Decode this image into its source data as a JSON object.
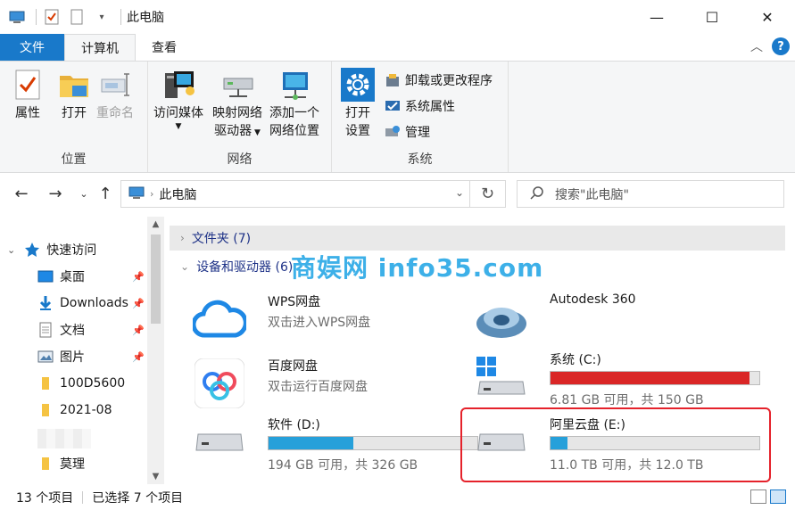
{
  "window": {
    "title": "此电脑"
  },
  "tabs": {
    "file": "文件",
    "computer": "计算机",
    "view": "查看"
  },
  "ribbon": {
    "location": {
      "label": "位置",
      "properties": "属性",
      "open": "打开",
      "rename": "重命名"
    },
    "network": {
      "label": "网络",
      "media": "访问媒体",
      "map_drive_1": "映射网络",
      "map_drive_2": "驱动器",
      "add_loc_1": "添加一个",
      "add_loc_2": "网络位置"
    },
    "system": {
      "label": "系统",
      "settings_1": "打开",
      "settings_2": "设置",
      "uninstall": "卸载或更改程序",
      "sys_props": "系统属性",
      "manage": "管理"
    }
  },
  "address": {
    "path": "此电脑",
    "search_placeholder": "搜索\"此电脑\""
  },
  "nav": {
    "quick_access": "快速访问",
    "items": [
      "桌面",
      "Downloads",
      "文档",
      "图片",
      "100D5600",
      "2021-08",
      "莫理"
    ]
  },
  "content": {
    "folders_section": "文件夹 (7)",
    "devices_section": "设备和驱动器 (6)",
    "watermark": "商娱网 info35.com",
    "wps": {
      "name": "WPS网盘",
      "sub": "双击进入WPS网盘"
    },
    "autodesk": {
      "name": "Autodesk 360"
    },
    "baidu": {
      "name": "百度网盘",
      "sub": "双击运行百度网盘"
    },
    "drive_c": {
      "name": "系统 (C:)",
      "free": "6.81 GB 可用，共 150 GB",
      "used_fraction": 0.955,
      "bar_color": "#da2626"
    },
    "drive_d": {
      "name": "软件 (D:)",
      "free": "194 GB 可用，共 326 GB",
      "used_fraction": 0.405,
      "bar_color": "#26a0da"
    },
    "drive_e": {
      "name": "阿里云盘 (E:)",
      "free": "11.0 TB 可用，共 12.0 TB",
      "used_fraction": 0.083,
      "bar_color": "#26a0da"
    }
  },
  "status": {
    "count": "13 个项目",
    "selected": "已选择 7 个项目"
  },
  "colors": {
    "accent": "#1979ca",
    "highlight_border": "#e5222b",
    "watermark": "#3db0e8"
  }
}
